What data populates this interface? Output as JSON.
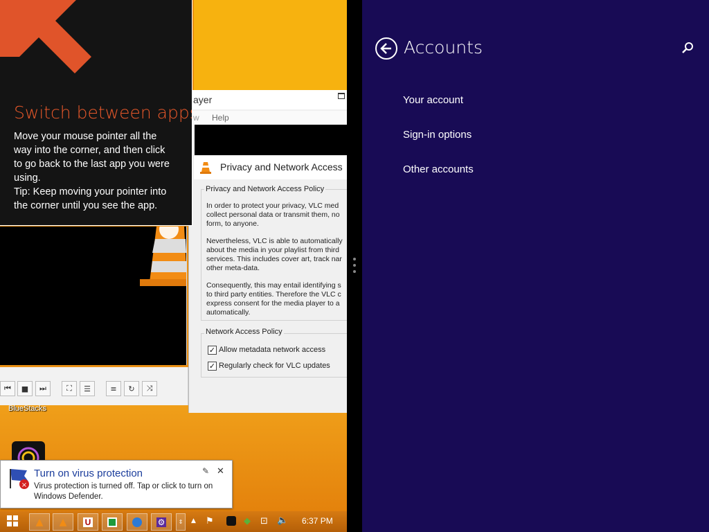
{
  "tutorial": {
    "title": "Switch between apps",
    "lines": [
      "Move your mouse pointer all the",
      "way into the corner, and then click",
      "to go back to the last app you were",
      "using.",
      "Tip: Keep moving your pointer into",
      "the corner until you see the app."
    ],
    "accent_color": "#e8582a"
  },
  "vlc": {
    "window_title": "ayer",
    "menu_view": "w",
    "menu_help": "Help"
  },
  "privacy_dialog": {
    "title": "Privacy and Network Access",
    "policy_group": "Privacy and Network Access Policy",
    "paragraphs": [
      [
        "In order to protect your privacy, VLC med",
        "collect personal data or transmit them, no",
        "form, to anyone."
      ],
      [
        "Nevertheless, VLC is able to automatically",
        "about the media in your playlist from third",
        "services. This includes cover art, track nar",
        "other meta-data."
      ],
      [
        "Consequently, this may entail identifying s",
        "to third party entities. Therefore the VLC c",
        "express consent for the media player to a",
        "automatically."
      ]
    ],
    "network_group": "Network Access Policy",
    "checkboxes": [
      {
        "label": "Allow metadata network access",
        "checked": true
      },
      {
        "label": "Regularly check for VLC updates",
        "checked": true
      }
    ]
  },
  "desktop": {
    "bluestacks_label": "BlueStacks"
  },
  "notification": {
    "title": "Turn on virus protection",
    "body_lines": [
      "Virus protection is turned off. Tap or click to turn on",
      "Windows Defender."
    ]
  },
  "taskbar": {
    "clock": "6:37 PM"
  },
  "settings": {
    "title": "Accounts",
    "nav_items": [
      "Your account",
      "Sign-in options",
      "Other accounts"
    ],
    "background_color": "#180b55"
  }
}
